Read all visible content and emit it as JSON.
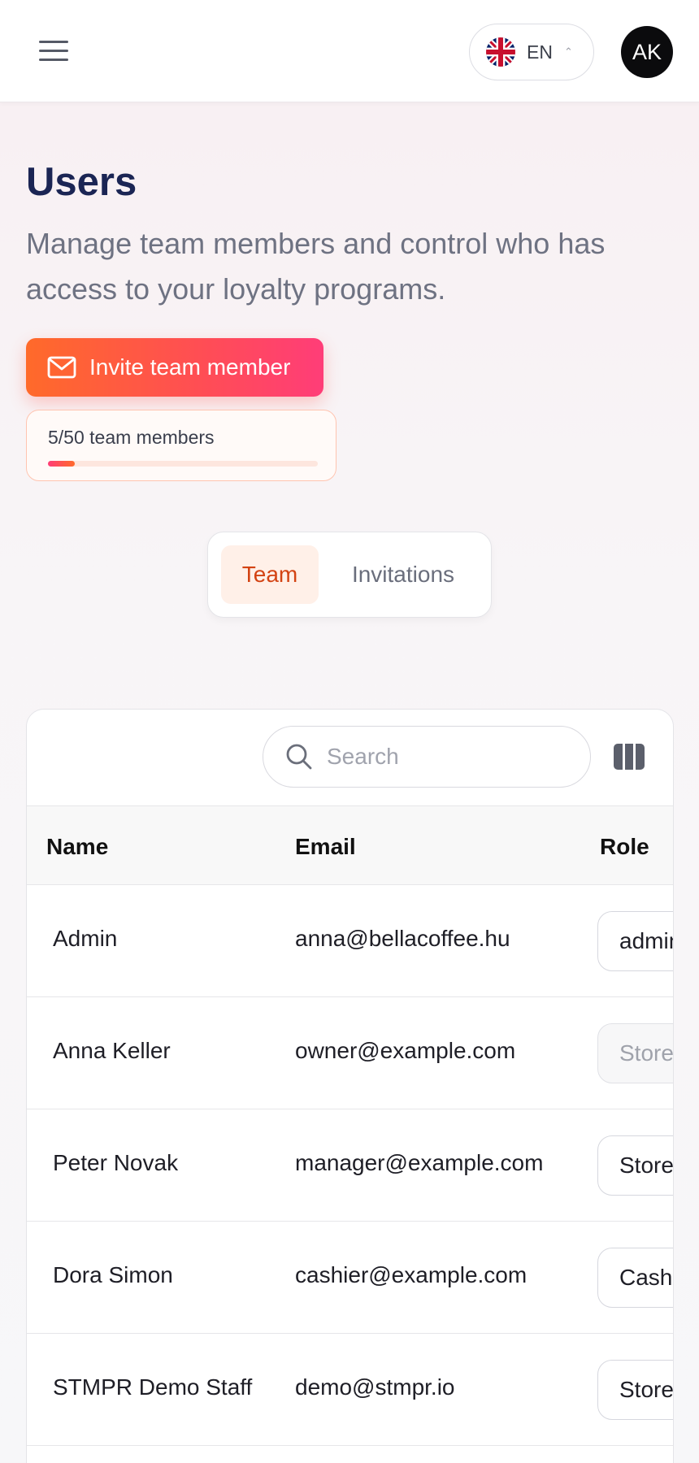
{
  "header": {
    "language": "EN",
    "avatar_initials": "AK"
  },
  "page": {
    "title": "Users",
    "subtitle": "Manage team members and control who has access to your loyalty programs.",
    "invite_label": "Invite team member",
    "members_text": "5/50 team members",
    "members_used": 5,
    "members_limit": 50,
    "accent_colors": [
      "#ff6a2a",
      "#ff3d78"
    ]
  },
  "tabs": [
    {
      "label": "Team",
      "active": true
    },
    {
      "label": "Invitations",
      "active": false
    }
  ],
  "table": {
    "search_placeholder": "Search",
    "columns": [
      "Name",
      "Email",
      "Role"
    ],
    "rows": [
      {
        "name": "Admin",
        "email": "anna@bellacoffee.hu",
        "role": "admin",
        "role_disabled": false
      },
      {
        "name": "Anna Keller",
        "email": "owner@example.com",
        "role": "Store",
        "role_disabled": true
      },
      {
        "name": "Peter Novak",
        "email": "manager@example.com",
        "role": "Store",
        "role_disabled": false
      },
      {
        "name": "Dora Simon",
        "email": "cashier@example.com",
        "role": "Cash",
        "role_disabled": false
      },
      {
        "name": "STMPR Demo Staff",
        "email": "demo@stmpr.io",
        "role": "Store",
        "role_disabled": false
      }
    ]
  }
}
